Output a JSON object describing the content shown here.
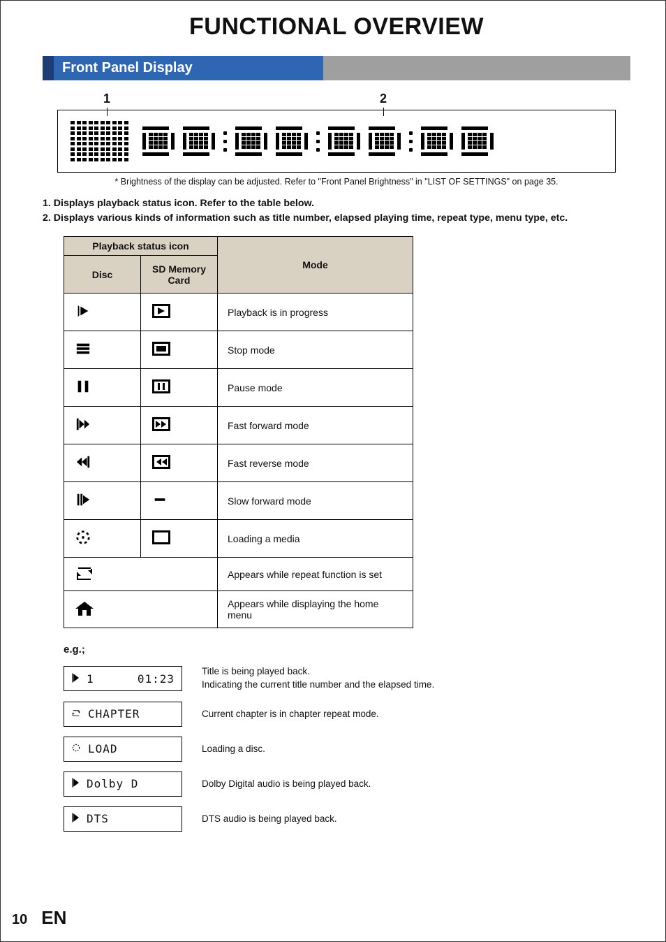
{
  "title": "FUNCTIONAL OVERVIEW",
  "section_heading": "Front Panel Display",
  "figure": {
    "marker1": "1",
    "marker2": "2"
  },
  "footnote": "* Brightness of the display can be adjusted. Refer to \"Front Panel Brightness\" in \"LIST OF SETTINGS\" on page 35.",
  "legend": [
    "1.  Displays playback status icon. Refer to the table below.",
    "2.  Displays various kinds of information such as title number, elapsed playing time, repeat type, menu type, etc."
  ],
  "table": {
    "header_group": "Playback status icon",
    "col_disc": "Disc",
    "col_sd": "SD Memory Card",
    "col_mode": "Mode",
    "rows": [
      {
        "disc_icon": "play-icon",
        "sd_icon": "sd-play-icon",
        "mode": "Playback is in progress"
      },
      {
        "disc_icon": "stop-icon",
        "sd_icon": "sd-stop-icon",
        "mode": "Stop mode"
      },
      {
        "disc_icon": "pause-icon",
        "sd_icon": "sd-pause-icon",
        "mode": "Pause mode"
      },
      {
        "disc_icon": "ffwd-icon",
        "sd_icon": "sd-ffwd-icon",
        "mode": "Fast forward mode"
      },
      {
        "disc_icon": "frev-icon",
        "sd_icon": "sd-frev-icon",
        "mode": "Fast reverse mode"
      },
      {
        "disc_icon": "slow-icon",
        "sd_icon": "dash-icon",
        "mode": "Slow forward mode"
      },
      {
        "disc_icon": "loading-icon",
        "sd_icon": "sd-blank-icon",
        "mode": "Loading a media"
      },
      {
        "span_icon": "repeat-icon",
        "mode": "Appears while repeat function is set"
      },
      {
        "span_icon": "home-icon",
        "mode": "Appears while displaying the home menu"
      }
    ]
  },
  "eg_label": "e.g.;",
  "examples": [
    {
      "icon": "play-icon",
      "lcd_left": "1",
      "lcd_right": "01:23",
      "desc": "Title is being played back.\nIndicating the current title number and the elapsed time."
    },
    {
      "icon": "repeat-icon",
      "lcd_text": "CHAPTER",
      "desc": "Current chapter is in chapter repeat mode."
    },
    {
      "icon": "loading-icon",
      "lcd_text": "LOAD",
      "desc": "Loading a disc."
    },
    {
      "icon": "play-icon",
      "lcd_text": "Dolby D",
      "desc": "Dolby Digital audio is being played back."
    },
    {
      "icon": "play-icon",
      "lcd_text": "DTS",
      "desc": "DTS audio is being played back."
    }
  ],
  "footer": {
    "page": "10",
    "lang": "EN"
  }
}
